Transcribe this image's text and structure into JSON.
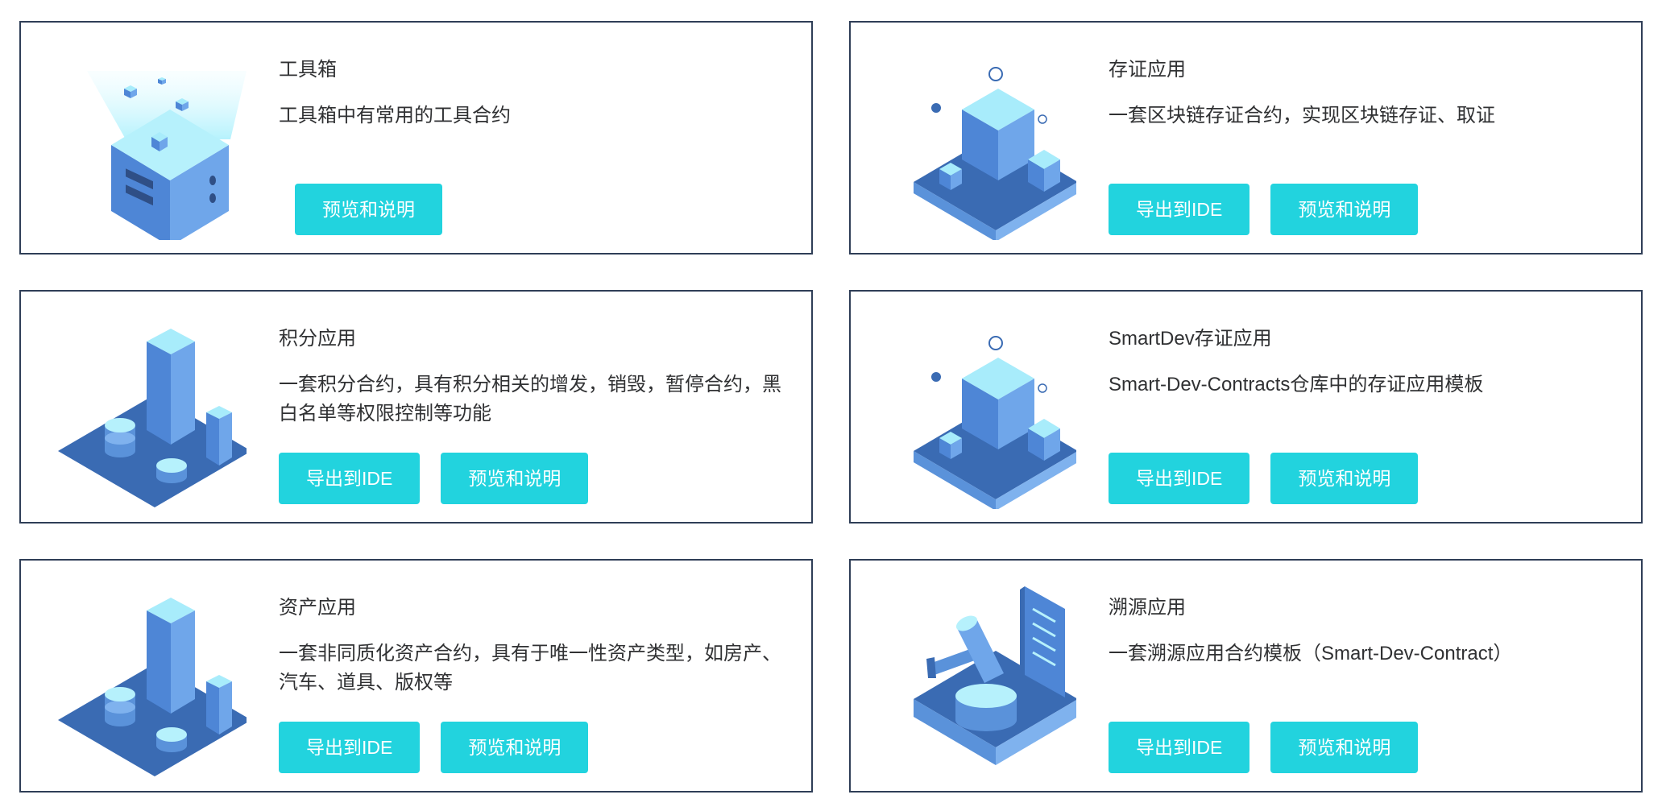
{
  "colors": {
    "accent_button": "#22d3de",
    "card_border": "#2f3e57",
    "text": "#303133",
    "illustration_dark": "#3a6bb3",
    "illustration_mid": "#5a92da",
    "illustration_light": "#a8ecfb"
  },
  "cards": [
    {
      "title": "工具箱",
      "description": "工具箱中有常用的工具合约",
      "icon": "toolbox-icon",
      "buttons": {
        "preview": "预览和说明"
      }
    },
    {
      "title": "存证应用",
      "description": "一套区块链存证合约，实现区块链存证、取证",
      "icon": "evidence-blocks-icon",
      "buttons": {
        "export": "导出到IDE",
        "preview": "预览和说明"
      }
    },
    {
      "title": "积分应用",
      "description": "一套积分合约，具有积分相关的增发，销毁，暂停合约，黑白名单等权限控制等功能",
      "icon": "points-city-icon",
      "buttons": {
        "export": "导出到IDE",
        "preview": "预览和说明"
      }
    },
    {
      "title": "SmartDev存证应用",
      "description": "Smart-Dev-Contracts仓库中的存证应用模板",
      "icon": "evidence-blocks-icon",
      "buttons": {
        "export": "导出到IDE",
        "preview": "预览和说明"
      }
    },
    {
      "title": "资产应用",
      "description": "一套非同质化资产合约，具有于唯一性资产类型，如房产、汽车、道具、版权等",
      "icon": "assets-city-icon",
      "buttons": {
        "export": "导出到IDE",
        "preview": "预览和说明"
      }
    },
    {
      "title": "溯源应用",
      "description": "一套溯源应用合约模板（Smart-Dev-Contract）",
      "icon": "traceability-gavel-icon",
      "buttons": {
        "export": "导出到IDE",
        "preview": "预览和说明"
      }
    }
  ]
}
